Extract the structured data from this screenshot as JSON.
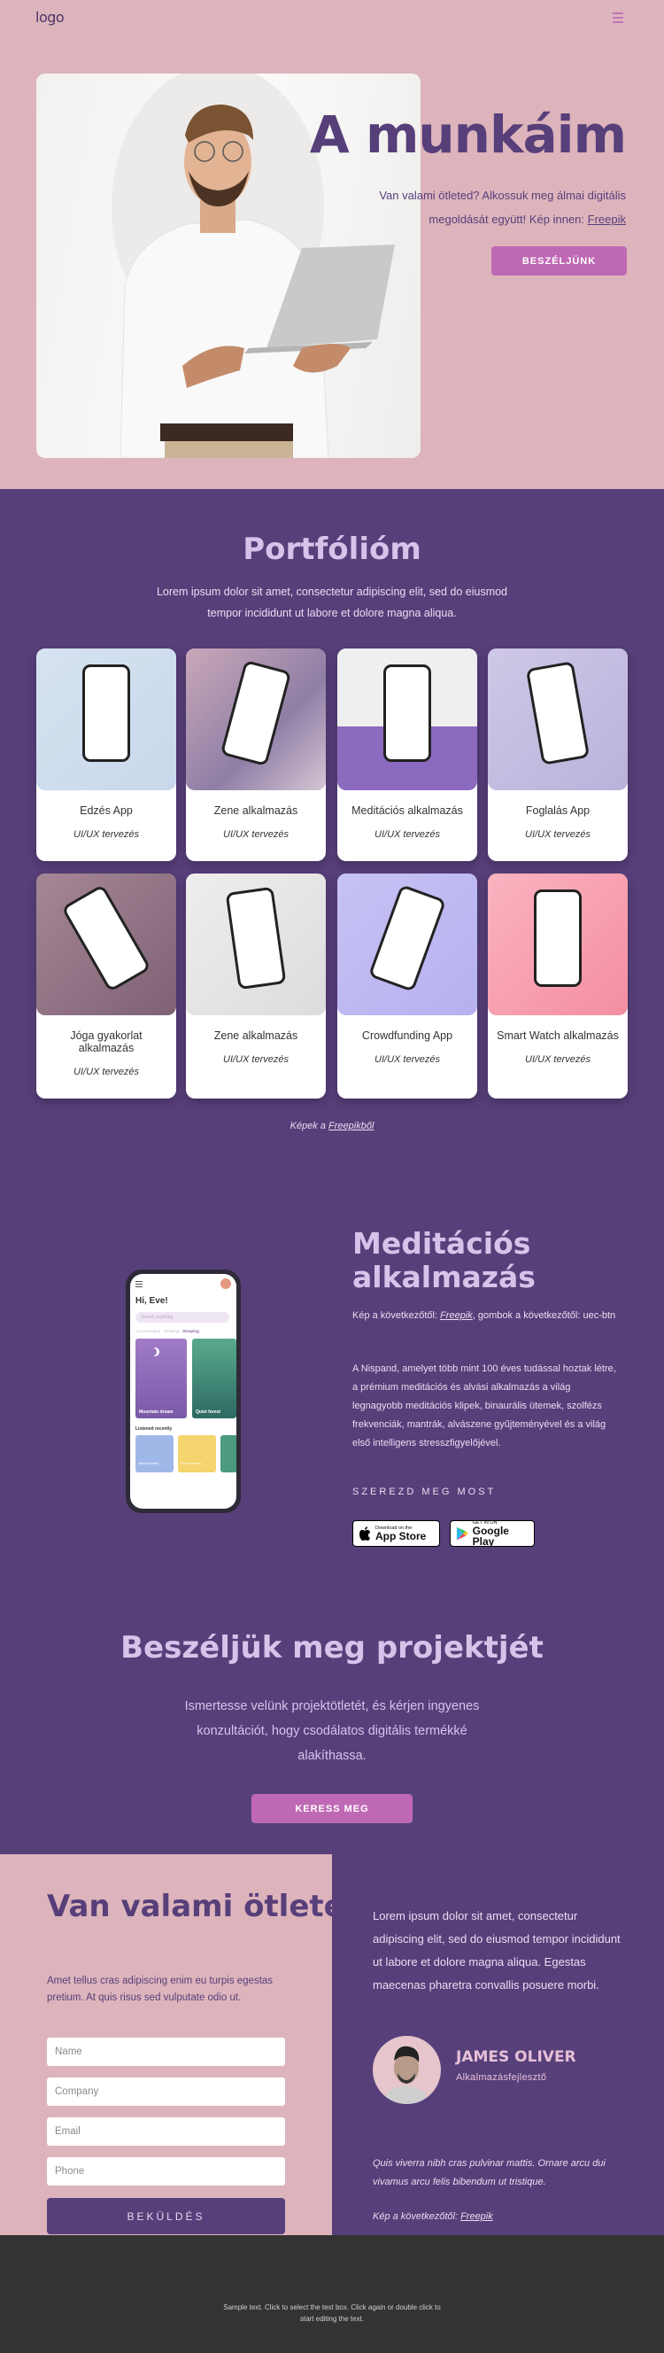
{
  "colors": {
    "pink_bg": "#ddb4bc",
    "purple_bg": "#573f7a",
    "accent_button": "#bf69b5",
    "heading_light": "#d7c3ea",
    "footer_bg": "#333333"
  },
  "header": {
    "logo": "logo",
    "menu_icon": "hamburger-menu-icon"
  },
  "hero": {
    "title": "A munkáim",
    "text": "Van valami ötleted? Alkossuk meg álmai digitális megoldását együtt! Kép innen: ",
    "link": "Freepik",
    "button": "BESZÉLJÜNK"
  },
  "portfolio": {
    "title": "Portfólióm",
    "subtitle": "Lorem ipsum dolor sit amet, consectetur adipiscing elit, sed do eiusmod tempor incididunt ut labore et dolore magna aliqua.",
    "cards": [
      {
        "name": "Edzés App",
        "tag": "UI/UX tervezés"
      },
      {
        "name": "Zene alkalmazás",
        "tag": "UI/UX tervezés"
      },
      {
        "name": "Meditációs alkalmazás",
        "tag": "UI/UX tervezés"
      },
      {
        "name": "Foglalás  App",
        "tag": "UI/UX tervezés"
      },
      {
        "name": "Jóga gyakorlat alkalmazás",
        "tag": "UI/UX tervezés"
      },
      {
        "name": "Zene alkalmazás",
        "tag": "UI/UX tervezés"
      },
      {
        "name": "Crowdfunding App",
        "tag": "UI/UX tervezés"
      },
      {
        "name": "Smart Watch alkalmazás",
        "tag": "UI/UX tervezés"
      }
    ],
    "credit_prefix": "Képek a ",
    "credit_link": "Freepikből"
  },
  "meditation": {
    "phone": {
      "greeting": "Hi, Eve!",
      "search_placeholder": "Search anything",
      "tabs": [
        "Concentrating",
        "Relaxing",
        "Sleeping"
      ],
      "cards": [
        "Mountain dream",
        "Quiet forest"
      ],
      "recent_label": "Listened recently",
      "recent": [
        "Wind journey",
        "Flower scent"
      ]
    },
    "title": "Meditációs alkalmazás",
    "credit_prefix": "Kép a következőtől: ",
    "credit_link": "Freepik",
    "credit_suffix": ", gombok a következőtől: uec-btn",
    "description": "A Nispand, amelyet több mint 100 éves tudással hoztak létre, a prémium meditációs és alvási alkalmazás a világ legnagyobb meditációs klipek, binaurális ütemek, szolfézs frekvenciák, mantrák, alvászene gyűjteményével és a világ első intelligens stresszfigyelőjével.",
    "get_now": "SZEREZD MEG MOST",
    "app_store": {
      "small": "Download on the",
      "big": "App Store"
    },
    "google_play": {
      "small": "GET IN ON",
      "big": "Google Play"
    }
  },
  "cta": {
    "title": "Beszéljük meg projektjét",
    "text": "Ismertesse velünk projektötletét, és kérjen ingyenes konzultációt, hogy csodálatos digitális termékké alakíthassa.",
    "button": "KERESS MEG"
  },
  "contact": {
    "title": "Van valami ötlete?",
    "subtitle": "Amet tellus cras adipiscing enim eu turpis egestas pretium. At quis risus sed vulputate odio ut.",
    "fields": {
      "name": "Name",
      "company": "Company",
      "email": "Email",
      "phone": "Phone"
    },
    "submit": "BEKÜLDÉS",
    "right_text": "Lorem ipsum dolor sit amet, consectetur adipiscing elit, sed do eiusmod tempor incididunt ut labore et dolore magna aliqua. Egestas maecenas pharetra convallis posuere morbi.",
    "person_name": "JAMES OLIVER",
    "person_role": "Alkalmazásfejlesztő",
    "quote": "Quis viverra nibh cras pulvinar mattis. Ornare arcu dui vivamus arcu felis bibendum ut tristique.",
    "credit_prefix": "Kép a következőtől: ",
    "credit_link": "Freepik"
  },
  "footer": {
    "text": "Sample text. Click to select the text box. Click again or double click to start editing the text."
  }
}
